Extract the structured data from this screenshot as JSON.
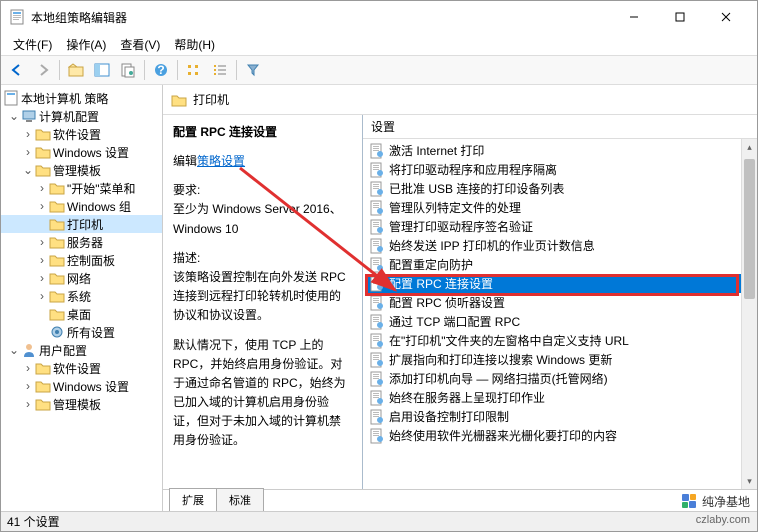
{
  "window": {
    "title": "本地组策略编辑器"
  },
  "menu": {
    "file": "文件(F)",
    "action": "操作(A)",
    "view": "查看(V)",
    "help": "帮助(H)"
  },
  "tree": {
    "root": "本地计算机 策略",
    "computer_config": "计算机配置",
    "software_settings": "软件设置",
    "windows_settings": "Windows 设置",
    "admin_templates": "管理模板",
    "start_menu": "\"开始\"菜单和",
    "windows_components": "Windows 组",
    "printers": "打印机",
    "servers": "服务器",
    "control_panel": "控制面板",
    "network": "网络",
    "system": "系统",
    "desktop": "桌面",
    "all_settings": "所有设置",
    "user_config": "用户配置",
    "software_settings2": "软件设置",
    "windows_settings2": "Windows 设置",
    "admin_templates2": "管理模板"
  },
  "content": {
    "header": "打印机",
    "title": "配置 RPC 连接设置",
    "edit_prefix": "编辑",
    "edit_link": "策略设置",
    "req_label": "要求:",
    "req_text": "至少为 Windows Server 2016、Windows 10",
    "desc_label": "描述:",
    "desc_p1": "该策略设置控制在向外发送 RPC 连接到远程打印轮转机时使用的协议和协议设置。",
    "desc_p2": "默认情况下，使用 TCP 上的 RPC，并始终启用身份验证。对于通过命名管道的 RPC，始终为已加入域的计算机启用身份验证，但对于未加入域的计算机禁用身份验证。"
  },
  "list": {
    "header": "设置",
    "items": [
      "激活 Internet 打印",
      "将打印驱动程序和应用程序隔离",
      "已批准 USB 连接的打印设备列表",
      "管理队列特定文件的处理",
      "管理打印驱动程序签名验证",
      "始终发送 IPP 打印机的作业页计数信息",
      "配置重定向防护",
      "配置 RPC 连接设置",
      "配置 RPC 侦听器设置",
      "通过 TCP 端口配置 RPC",
      "在\"打印机\"文件夹的左窗格中自定义支持 URL",
      "扩展指向和打印连接以搜索 Windows 更新",
      "添加打印机向导 — 网络扫描页(托管网络)",
      "始终在服务器上呈现打印作业",
      "启用设备控制打印限制",
      "始终使用软件光栅器来光栅化要打印的内容"
    ],
    "selected_index": 7
  },
  "tabs": {
    "extended": "扩展",
    "standard": "标准"
  },
  "status": {
    "text": "41 个设置"
  },
  "watermark": {
    "text": "纯净基地",
    "url": "czlaby.com"
  }
}
